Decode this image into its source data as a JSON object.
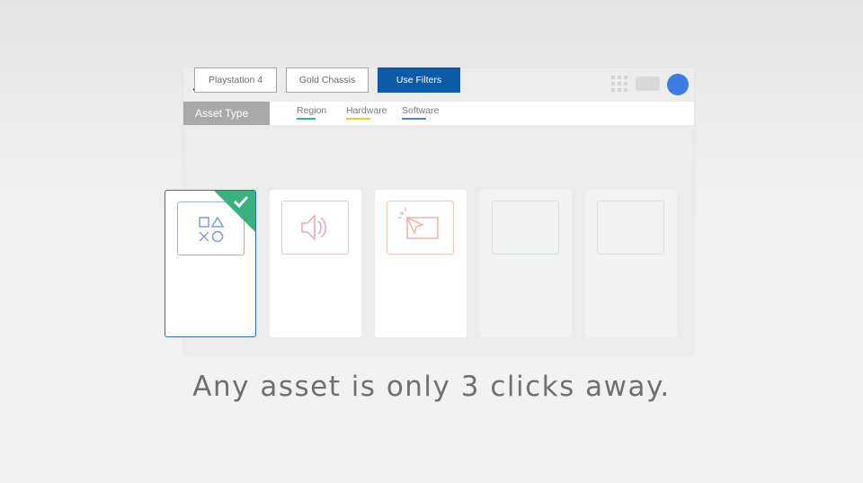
{
  "header": {
    "logo_icon": "playstation-logo-icon",
    "apps_icon": "grid-icon",
    "avatar_color": "#3d7de3"
  },
  "filter_bar": {
    "asset_type_label": "Asset Type",
    "tabs": [
      {
        "label": "Region",
        "accent": "#3bb07f"
      },
      {
        "label": "Hardware",
        "accent": "#f2c531"
      },
      {
        "label": "Software",
        "accent": "#4a86d8"
      }
    ]
  },
  "filters": {
    "chips": [
      "Playstation 4",
      "Gold Chassis"
    ],
    "apply_label": "Use Filters",
    "apply_color": "#0d5aa8"
  },
  "cards": [
    {
      "icon": "playstation-shapes-icon",
      "state": "selected",
      "selected_badge_icon": "check-icon",
      "accent": "#2e6db8"
    },
    {
      "icon": "speaker-icon",
      "state": "available",
      "accent": "#e8a8b4"
    },
    {
      "icon": "cursor-click-screen-icon",
      "state": "available",
      "accent": "#f0b3a8"
    },
    {
      "icon": "placeholder-icon",
      "state": "faded",
      "accent": "#cfe3e3"
    },
    {
      "icon": "placeholder-icon",
      "state": "faded",
      "accent": "#dedede"
    }
  ],
  "tagline": "Any asset is only 3 clicks away."
}
